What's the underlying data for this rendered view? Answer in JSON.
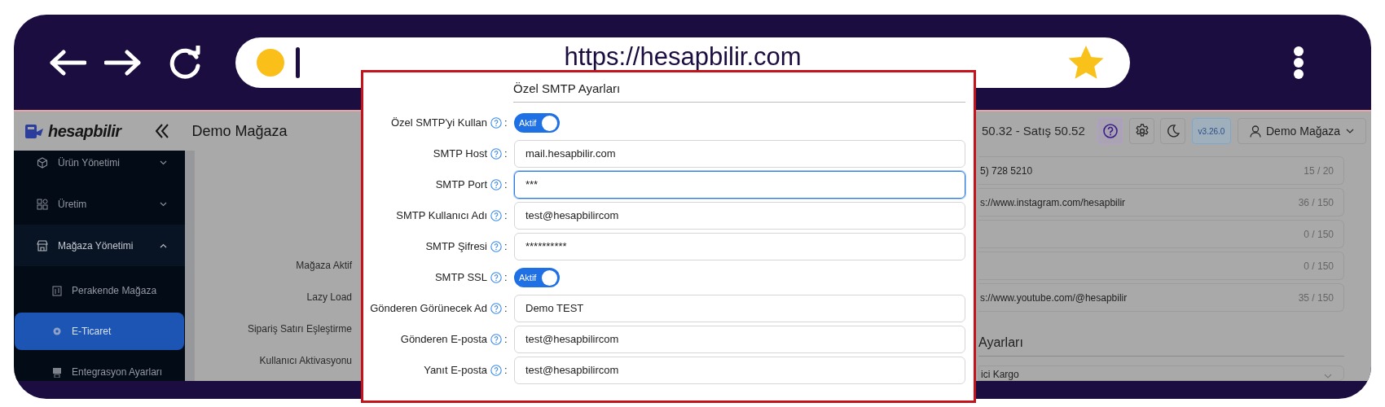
{
  "browser": {
    "url": "https://hesapbilir.com"
  },
  "app": {
    "logo": "hesapbilir",
    "title": "Demo Mağaza",
    "exchange": "50.32 - Satış 50.52",
    "version": "v3.26.0",
    "user": "Demo Mağaza"
  },
  "sidebar": {
    "items": [
      {
        "label": "Ürün Yönetimi",
        "expanded": false,
        "selected": false
      },
      {
        "label": "Üretim",
        "expanded": false,
        "selected": false
      },
      {
        "label": "Mağaza Yönetimi",
        "expanded": true,
        "selected": false,
        "children": [
          {
            "label": "Perakende Mağaza",
            "selected": false
          },
          {
            "label": "E-Ticaret",
            "selected": true
          },
          {
            "label": "Entegrasyon Ayarları",
            "selected": false
          }
        ]
      }
    ]
  },
  "background_form": {
    "labels": [
      "Mağaza Aktif",
      "Lazy Load",
      "Sipariş Satırı Eşleştirme",
      "Kullanıcı Aktivasyonu"
    ],
    "fields": [
      {
        "value": "5) 728 5210",
        "count": "15 / 20"
      },
      {
        "value": "s://www.instagram.com/hesapbilir",
        "count": "36 / 150"
      },
      {
        "count": "0 / 150"
      },
      {
        "count": "0 / 150"
      },
      {
        "value": "s://www.youtube.com/@hesapbilir",
        "count": "35 / 150"
      }
    ],
    "section_heading": "Ayarları",
    "select_value": "ici Kargo"
  },
  "modal": {
    "title": "Özel SMTP Ayarları",
    "rows": [
      {
        "kind": "toggle",
        "label": "Özel SMTP'yi Kullan",
        "separator": ":",
        "toggle_label": "Aktif",
        "on": true
      },
      {
        "kind": "input",
        "label": "SMTP Host",
        "separator": ":",
        "value": "mail.hesapbilir.com",
        "focused": false
      },
      {
        "kind": "input",
        "label": "SMTP Port",
        "separator": ":",
        "value": "***",
        "focused": true
      },
      {
        "kind": "input",
        "label": "SMTP Kullanıcı Adı",
        "separator": ":",
        "value": "test@hesapbilircom",
        "focused": false
      },
      {
        "kind": "input",
        "label": "SMTP Şifresi",
        "separator": ":",
        "value": "**********",
        "focused": false
      },
      {
        "kind": "toggle",
        "label": "SMTP SSL",
        "separator": ":",
        "toggle_label": "Aktif",
        "on": true
      },
      {
        "kind": "input",
        "label": "Gönderen Görünecek Ad",
        "separator": ":",
        "value": "Demo TEST",
        "focused": false
      },
      {
        "kind": "input",
        "label": "Gönderen E-posta",
        "separator": ":",
        "value": "test@hesapbilircom",
        "focused": false
      },
      {
        "kind": "input",
        "label": "Yanıt E-posta",
        "separator": ":",
        "value": "test@hesapbilircom",
        "focused": false
      }
    ]
  }
}
